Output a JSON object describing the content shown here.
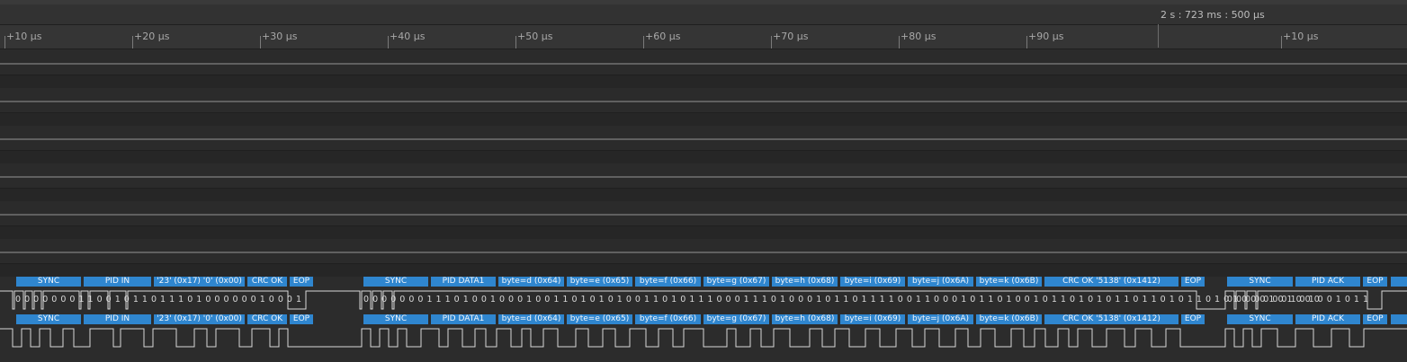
{
  "timestamp": "2 s : 723 ms : 500 µs",
  "ruler_labels": [
    "+10 µs",
    "+20 µs",
    "+30 µs",
    "+40 µs",
    "+50 µs",
    "+60 µs",
    "+70 µs",
    "+80 µs",
    "+90 µs",
    "+10 µs"
  ],
  "packets_row1": [
    {
      "label": "SYNC"
    },
    {
      "label": "PID IN"
    },
    {
      "label": "'23' (0x17) '0' (0x00)"
    },
    {
      "label": "CRC OK"
    },
    {
      "label": "EOP"
    },
    {
      "label": "SYNC"
    },
    {
      "label": "PID DATA1"
    },
    {
      "label": "byte=d (0x64)"
    },
    {
      "label": "byte=e (0x65)"
    },
    {
      "label": "byte=f (0x66)"
    },
    {
      "label": "byte=g (0x67)"
    },
    {
      "label": "byte=h (0x68)"
    },
    {
      "label": "byte=i (0x69)"
    },
    {
      "label": "byte=j (0x6A)"
    },
    {
      "label": "byte=k (0x6B)"
    },
    {
      "label": "CRC OK '5138' (0x1412)"
    },
    {
      "label": "EOP"
    },
    {
      "label": "SYNC"
    },
    {
      "label": "PID ACK"
    },
    {
      "label": "EOP"
    },
    {
      "label": ""
    }
  ],
  "bits": [
    {
      "text": "0 0 0 0 0 0 0 1 1 0 0 1 0 1 1 0 1 1 1 0 1 0 0 0 0 0 0 1 0 0 0 1"
    },
    {
      "text": "0 0 0 0 0 0 0 1 1 1 0 1 0 0 1 0 0 0 1 0 0 1 1 0 1 0 1 0 1 0 0 1 1 0 1 0 1 1 1 0 0 0 1 1 1 0 1 0 0 0 1 0 1 1 0 1 1 1 1 0 0 1 1 0 0 0 1 0 1 1 0 1 0 0 1 0 1 1 0 1 0 1 0 1 1 0 1 1 0 1 0 1 1 0 1 0 1 0 0 0 1 0 1 0 0 0"
    },
    {
      "text": "0 0 0 0 0 0 0 1 0 1 0 0 1 0 1 1"
    }
  ],
  "colors": {
    "decode": "#2f86cf",
    "wave": "#d9d9d9",
    "background": "#2c2c2c"
  }
}
